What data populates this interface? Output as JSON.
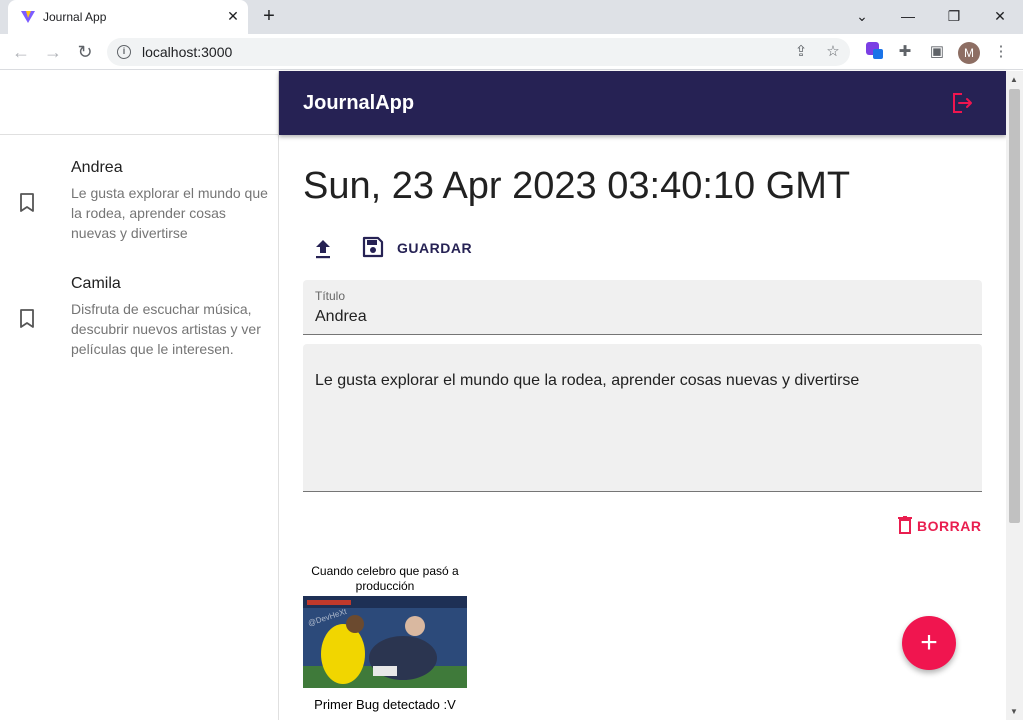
{
  "browser": {
    "tab_title": "Journal App",
    "url": "localhost:3000",
    "profile_initial": "M"
  },
  "app": {
    "title": "JournalApp"
  },
  "sidebar": {
    "entries": [
      {
        "title": "Andrea",
        "body": "Le gusta explorar el mundo que la rodea, aprender cosas nuevas y divertirse"
      },
      {
        "title": "Camila",
        "body": "Disfruta de escuchar música, descubrir nuevos artistas y ver películas que le interesen."
      }
    ]
  },
  "note": {
    "date": "Sun, 23 Apr 2023 03:40:10 GMT",
    "save_label": "GUARDAR",
    "title_label": "Título",
    "title_value": "Andrea",
    "body_value": "Le gusta explorar el mundo que la rodea, aprender cosas nuevas y divertirse",
    "delete_label": "BORRAR"
  },
  "meme": {
    "top_text": "Cuando celebro que pasó a producción",
    "watermark": "@DevHeXt",
    "bottom_text": "Primer Bug detectado :V"
  },
  "colors": {
    "appbar": "#262254",
    "accent": "#f0154f",
    "danger": "#e91e4f"
  }
}
